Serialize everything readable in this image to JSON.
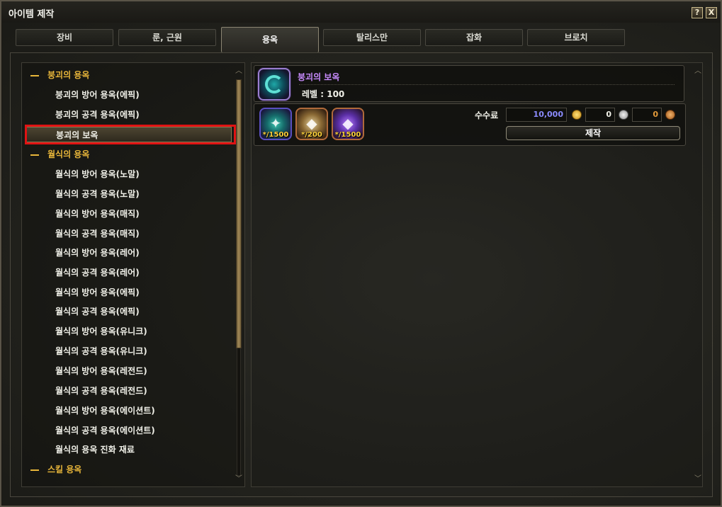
{
  "window": {
    "title": "아이템 제작",
    "help_label": "?",
    "close_label": "X"
  },
  "tabs": [
    {
      "label": "장비",
      "active": false
    },
    {
      "label": "룬, 근원",
      "active": false
    },
    {
      "label": "용옥",
      "active": true
    },
    {
      "label": "탈리스만",
      "active": false
    },
    {
      "label": "잡화",
      "active": false
    },
    {
      "label": "브로치",
      "active": false
    }
  ],
  "tree": [
    {
      "type": "category",
      "label": "붕괴의 용옥"
    },
    {
      "type": "item",
      "label": "붕괴의 방어 용옥(에픽)"
    },
    {
      "type": "item",
      "label": "붕괴의 공격 용옥(에픽)"
    },
    {
      "type": "item",
      "label": "붕괴의 보옥",
      "selected": true
    },
    {
      "type": "category",
      "label": "월식의 용옥"
    },
    {
      "type": "item",
      "label": "월식의 방어 용옥(노말)"
    },
    {
      "type": "item",
      "label": "월식의 공격 용옥(노말)"
    },
    {
      "type": "item",
      "label": "월식의 방어 용옥(매직)"
    },
    {
      "type": "item",
      "label": "월식의 공격 용옥(매직)"
    },
    {
      "type": "item",
      "label": "월식의 방어 용옥(레어)"
    },
    {
      "type": "item",
      "label": "월식의 공격 용옥(레어)"
    },
    {
      "type": "item",
      "label": "월식의 방어 용옥(에픽)"
    },
    {
      "type": "item",
      "label": "월식의 공격 용옥(에픽)"
    },
    {
      "type": "item",
      "label": "월식의 방어 용옥(유니크)"
    },
    {
      "type": "item",
      "label": "월식의 공격 용옥(유니크)"
    },
    {
      "type": "item",
      "label": "월식의 방어 용옥(레전드)"
    },
    {
      "type": "item",
      "label": "월식의 공격 용옥(레전드)"
    },
    {
      "type": "item",
      "label": "월식의 방어 용옥(에이션트)"
    },
    {
      "type": "item",
      "label": "월식의 공격 용옥(에이션트)"
    },
    {
      "type": "item",
      "label": "월식의 용옥 진화 재료"
    },
    {
      "type": "category",
      "label": "스킬 용옥"
    }
  ],
  "recipe": {
    "result_name": "붕괴의 보옥",
    "level_label": "레벨 : 100",
    "materials": [
      {
        "icon": "teal-crystal-cluster-icon",
        "count": "*/1500"
      },
      {
        "icon": "golden-rune-stone-icon",
        "count": "*/200"
      },
      {
        "icon": "purple-crystal-icon",
        "count": "*/1500"
      }
    ],
    "fee_label": "수수료",
    "fee_gold": "10,000",
    "fee_silver": "0",
    "fee_copper": "0",
    "craft_label": "제작"
  },
  "scroll": {
    "up": "︿",
    "down": "﹀"
  }
}
